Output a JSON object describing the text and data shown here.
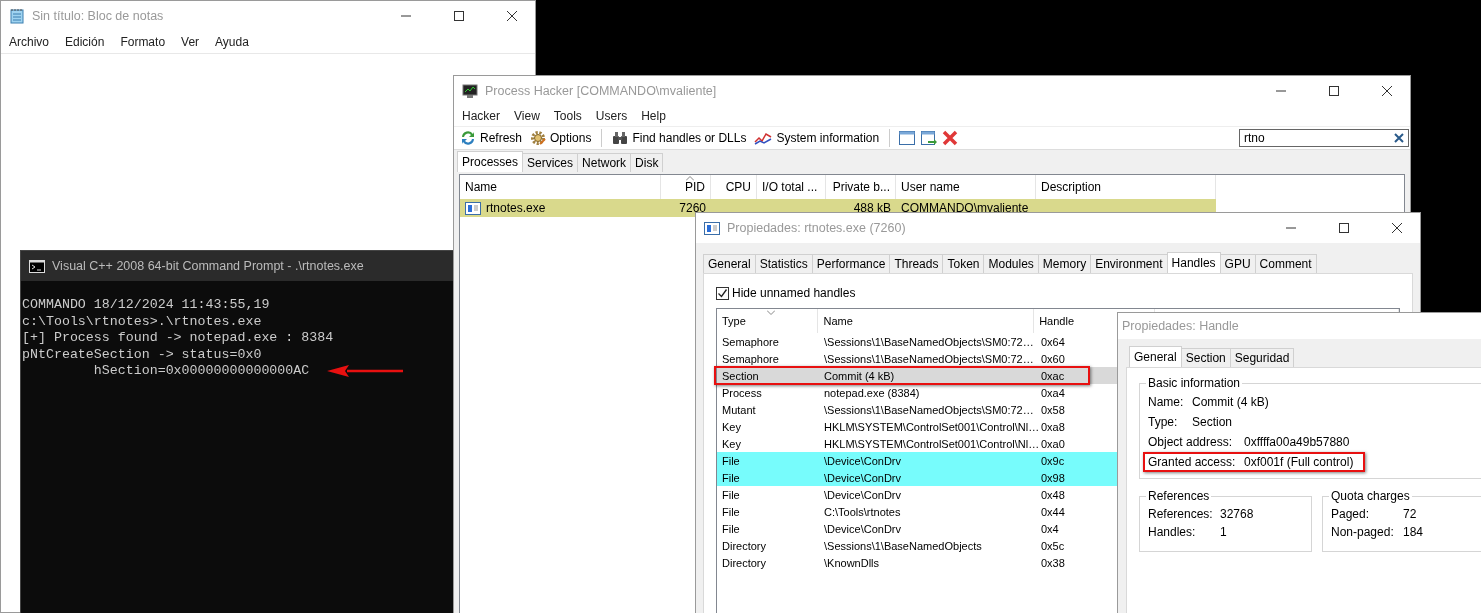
{
  "notepad": {
    "title": "Sin título: Bloc de notas",
    "menu": [
      "Archivo",
      "Edición",
      "Formato",
      "Ver",
      "Ayuda"
    ]
  },
  "console": {
    "title": "Visual C++ 2008 64-bit Command Prompt - .\\rtnotes.exe",
    "lines": [
      {
        "text": "COMMANDO 18/12/2024 11:43:55,19",
        "arrow": false
      },
      {
        "text": "c:\\Tools\\rtnotes>.\\rtnotes.exe",
        "arrow": false
      },
      {
        "text": "[+] Process found -> notepad.exe : 8384",
        "arrow": false
      },
      {
        "text": "pNtCreateSection -> status=0x0",
        "arrow": false
      },
      {
        "text": "         hSection=0x00000000000000AC",
        "arrow": true
      }
    ]
  },
  "process_hacker": {
    "title": "Process Hacker [COMMANDO\\mvaliente]",
    "menu": [
      "Hacker",
      "View",
      "Tools",
      "Users",
      "Help"
    ],
    "toolbar": [
      {
        "label": "Refresh",
        "kind": "refresh"
      },
      {
        "label": "Options",
        "kind": "options"
      },
      {
        "label": "Find handles or DLLs",
        "kind": "find"
      },
      {
        "label": "System information",
        "kind": "sysinfo"
      }
    ],
    "search": {
      "value": "rtno"
    },
    "tabs": [
      {
        "label": "Processes",
        "selected": true
      },
      {
        "label": "Services",
        "selected": false
      },
      {
        "label": "Network",
        "selected": false
      },
      {
        "label": "Disk",
        "selected": false
      }
    ],
    "columns": [
      "Name",
      "PID",
      "CPU",
      "I/O total ...",
      "Private b...",
      "User name",
      "Description"
    ],
    "rows": [
      {
        "name": "rtnotes.exe",
        "pid": "7260",
        "private_bytes": "488 kB",
        "user_name": "COMMANDO\\mvaliente",
        "color": "#d9d98c"
      }
    ]
  },
  "process_properties": {
    "title": "Propiedades: rtnotes.exe (7260)",
    "tabs": [
      {
        "label": "General",
        "selected": false
      },
      {
        "label": "Statistics",
        "selected": false
      },
      {
        "label": "Performance",
        "selected": false
      },
      {
        "label": "Threads",
        "selected": false
      },
      {
        "label": "Token",
        "selected": false
      },
      {
        "label": "Modules",
        "selected": false
      },
      {
        "label": "Memory",
        "selected": false
      },
      {
        "label": "Environment",
        "selected": false
      },
      {
        "label": "Handles",
        "selected": true
      },
      {
        "label": "GPU",
        "selected": false
      },
      {
        "label": "Comment",
        "selected": false
      }
    ],
    "hide_unnamed": {
      "label": "Hide unnamed handles",
      "checked": true
    },
    "columns": [
      "Type",
      "Name",
      "Handle"
    ],
    "rows": [
      {
        "type": "Semaphore",
        "name": "\\Sessions\\1\\BaseNamedObjects\\SM0:72…",
        "handle": "0x64",
        "selected": false,
        "boxed": false
      },
      {
        "type": "Semaphore",
        "name": "\\Sessions\\1\\BaseNamedObjects\\SM0:72…",
        "handle": "0x60",
        "selected": false,
        "boxed": false
      },
      {
        "type": "Section",
        "name": "Commit (4 kB)",
        "handle": "0xac",
        "selected": true,
        "boxed": true
      },
      {
        "type": "Process",
        "name": "notepad.exe (8384)",
        "handle": "0xa4",
        "selected": false,
        "boxed": false
      },
      {
        "type": "Mutant",
        "name": "\\Sessions\\1\\BaseNamedObjects\\SM0:72…",
        "handle": "0x58",
        "selected": false,
        "boxed": false
      },
      {
        "type": "Key",
        "name": "HKLM\\SYSTEM\\ControlSet001\\Control\\Nl…",
        "handle": "0xa8",
        "selected": false,
        "boxed": false
      },
      {
        "type": "Key",
        "name": "HKLM\\SYSTEM\\ControlSet001\\Control\\Nl…",
        "handle": "0xa0",
        "selected": false,
        "boxed": false
      },
      {
        "type": "File",
        "name": "\\Device\\ConDrv",
        "handle": "0x9c",
        "selected": false,
        "boxed": false,
        "color": "#77fcfc"
      },
      {
        "type": "File",
        "name": "\\Device\\ConDrv",
        "handle": "0x98",
        "selected": false,
        "boxed": false,
        "color": "#77fcfc"
      },
      {
        "type": "File",
        "name": "\\Device\\ConDrv",
        "handle": "0x48",
        "selected": false,
        "boxed": false
      },
      {
        "type": "File",
        "name": "C:\\Tools\\rtnotes",
        "handle": "0x44",
        "selected": false,
        "boxed": false
      },
      {
        "type": "File",
        "name": "\\Device\\ConDrv",
        "handle": "0x4",
        "selected": false,
        "boxed": false
      },
      {
        "type": "Directory",
        "name": "\\Sessions\\1\\BaseNamedObjects",
        "handle": "0x5c",
        "selected": false,
        "boxed": false
      },
      {
        "type": "Directory",
        "name": "\\KnownDlls",
        "handle": "0x38",
        "selected": false,
        "boxed": false
      }
    ]
  },
  "handle_properties": {
    "title": "Propiedades: Handle",
    "tabs": [
      {
        "label": "General",
        "selected": true
      },
      {
        "label": "Section",
        "selected": false
      },
      {
        "label": "Seguridad",
        "selected": false
      }
    ],
    "basic_information": {
      "title": "Basic information",
      "fields": [
        {
          "label": "Name:",
          "value": "Commit (4 kB)",
          "boxed": false
        },
        {
          "label": "Type:",
          "value": "Section",
          "boxed": false
        },
        {
          "label": "Object address:",
          "value": "0xffffa00a49b57880",
          "boxed": false
        },
        {
          "label": "Granted access:",
          "value": "0xf001f (Full control)",
          "boxed": true
        }
      ]
    },
    "references": {
      "title": "References",
      "fields": [
        {
          "label": "References:",
          "value": "32768"
        },
        {
          "label": "Handles:",
          "value": "1"
        }
      ]
    },
    "quota_charges": {
      "title": "Quota charges",
      "fields": [
        {
          "label": "Paged:",
          "value": "72"
        },
        {
          "label": "Non-paged:",
          "value": "184"
        }
      ]
    }
  }
}
